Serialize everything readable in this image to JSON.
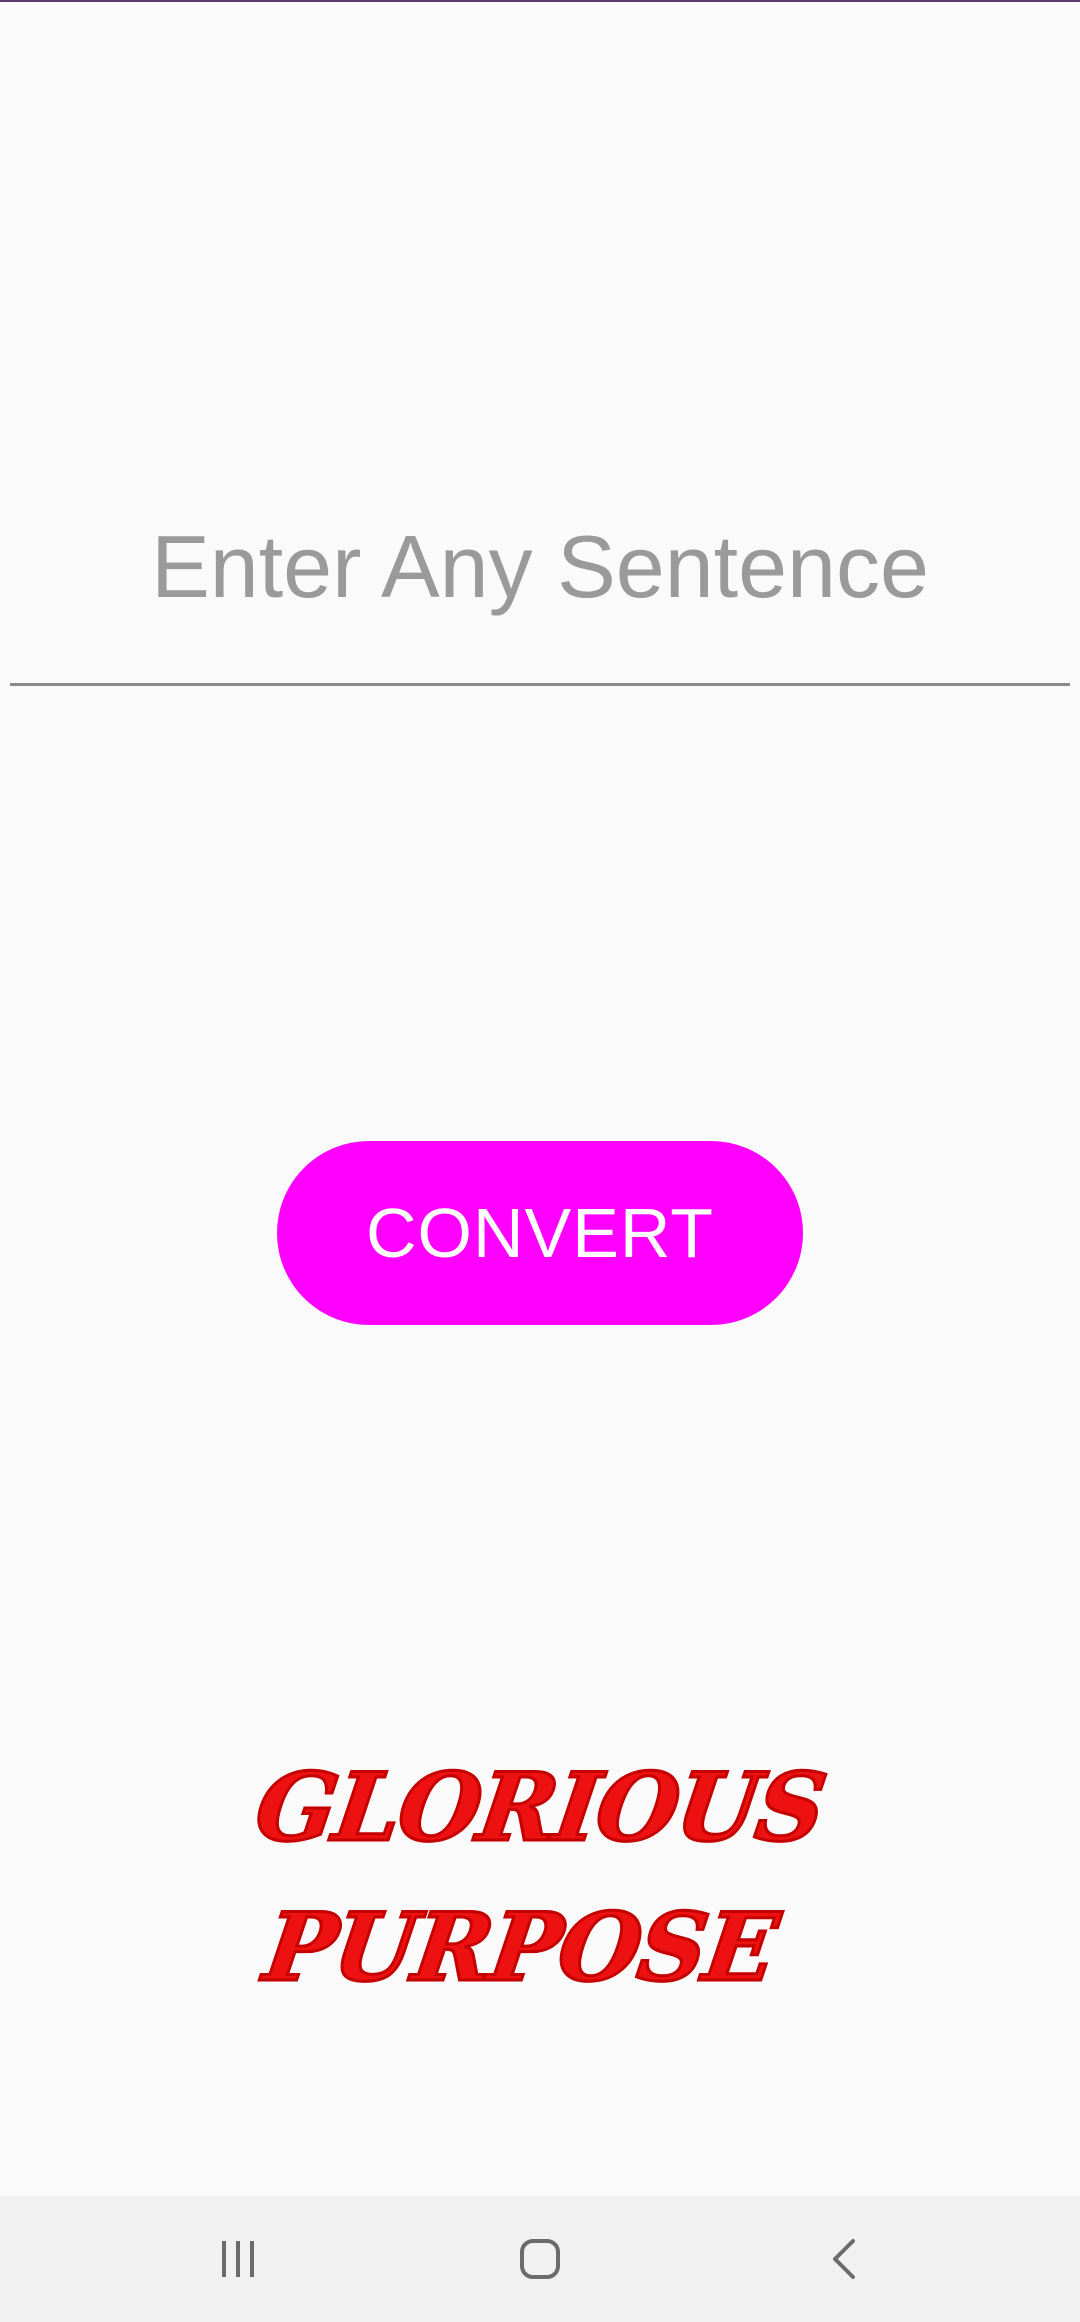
{
  "colors": {
    "background": "#fafafa",
    "accent": "#ff00ff",
    "result_text": "#ee1111",
    "placeholder": "#9a9a9a",
    "navbar": "#f1f1f1"
  },
  "sentence_input": {
    "value": "",
    "placeholder": "Enter Any Sentence"
  },
  "convert_button": {
    "label": "CONVERT"
  },
  "result": {
    "text": "GLORIOUS PURPOSE"
  },
  "navbar": {
    "icons": [
      "recent-apps-icon",
      "home-icon",
      "back-icon"
    ]
  }
}
